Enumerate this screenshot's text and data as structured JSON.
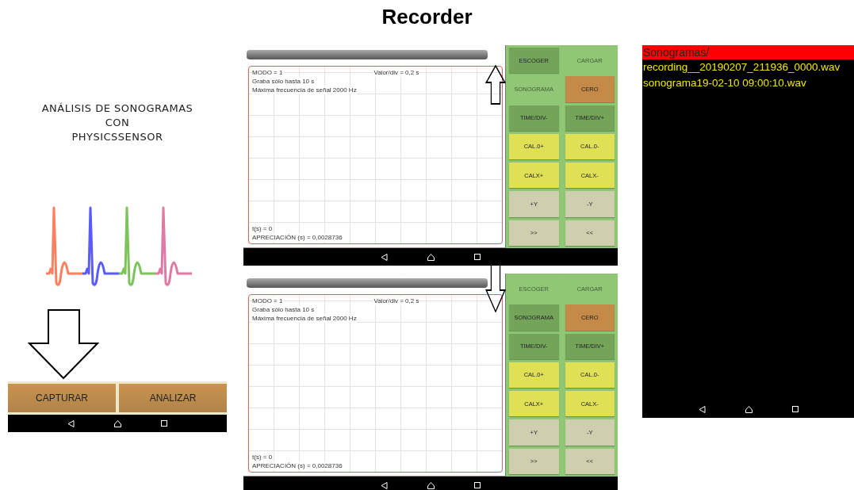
{
  "title": "Recorder",
  "home_screen": {
    "heading": "ANÁLISIS DE SONOGRAMAS\nCON\nPHYSICSSENSOR",
    "buttons": [
      "CAPTURAR",
      "ANALIZAR"
    ]
  },
  "recorder_screens": [
    {
      "plot": {
        "mode": "MODO = 1",
        "scale": "Valor/div = 0,2 s",
        "limit": "Graba sólo hasta 10 s",
        "max_freq": "Máxima frecuencia de señal 2000 Hz",
        "time": "t(s) = 0",
        "resolution": "APRECIACIÓN (s) = 0,0028736"
      },
      "buttons": [
        {
          "label": "ESCOGER",
          "kind": "action",
          "disabled": false
        },
        {
          "label": "CARGAR",
          "kind": "action",
          "disabled": true
        },
        {
          "label": "SONOGRAMA",
          "kind": "action",
          "disabled": true
        },
        {
          "label": "CERO",
          "kind": "zero",
          "disabled": false
        },
        {
          "label": "TIME/DIV-",
          "kind": "action",
          "disabled": false
        },
        {
          "label": "TIME/DIV+",
          "kind": "action",
          "disabled": false
        },
        {
          "label": "CAL.0+",
          "kind": "calibrate",
          "disabled": false
        },
        {
          "label": "CAL.0-",
          "kind": "calibrate",
          "disabled": false
        },
        {
          "label": "CALX+",
          "kind": "calibrate",
          "disabled": false
        },
        {
          "label": "CALX-",
          "kind": "calibrate",
          "disabled": false
        },
        {
          "label": "+Y",
          "kind": "move",
          "disabled": false
        },
        {
          "label": "-Y",
          "kind": "move",
          "disabled": false
        },
        {
          "label": ">>",
          "kind": "move",
          "disabled": false
        },
        {
          "label": "<<",
          "kind": "move",
          "disabled": false
        }
      ]
    },
    {
      "plot": {
        "mode": "MODO = 1",
        "scale": "Valor/div = 0,2 s",
        "limit": "Graba sólo hasta 10 s",
        "max_freq": "Máxima frecuencia de señal 2000 Hz",
        "time": "t(s) = 0",
        "resolution": "APRECIACIÓN (s) = 0,0028736"
      },
      "buttons": [
        {
          "label": "ESCOGER",
          "kind": "action",
          "disabled": true
        },
        {
          "label": "CARGAR",
          "kind": "action",
          "disabled": true
        },
        {
          "label": "SONOGRAMA",
          "kind": "action",
          "disabled": false
        },
        {
          "label": "CERO",
          "kind": "zero",
          "disabled": false
        },
        {
          "label": "TIME/DIV-",
          "kind": "action",
          "disabled": false
        },
        {
          "label": "TIME/DIV+",
          "kind": "action",
          "disabled": false
        },
        {
          "label": "CAL.0+",
          "kind": "calibrate",
          "disabled": false
        },
        {
          "label": "CAL.0-",
          "kind": "calibrate",
          "disabled": false
        },
        {
          "label": "CALX+",
          "kind": "calibrate",
          "disabled": false
        },
        {
          "label": "CALX-",
          "kind": "calibrate",
          "disabled": false
        },
        {
          "label": "+Y",
          "kind": "move",
          "disabled": false
        },
        {
          "label": "-Y",
          "kind": "move",
          "disabled": false
        },
        {
          "label": ">>",
          "kind": "move",
          "disabled": false
        },
        {
          "label": "<<",
          "kind": "move",
          "disabled": false
        }
      ]
    }
  ],
  "file_list": {
    "folder": "Sonogramas/",
    "files": [
      "recording__20190207_211936_0000.wav",
      "sonograma19-02-10 09:00:10.wav"
    ]
  }
}
